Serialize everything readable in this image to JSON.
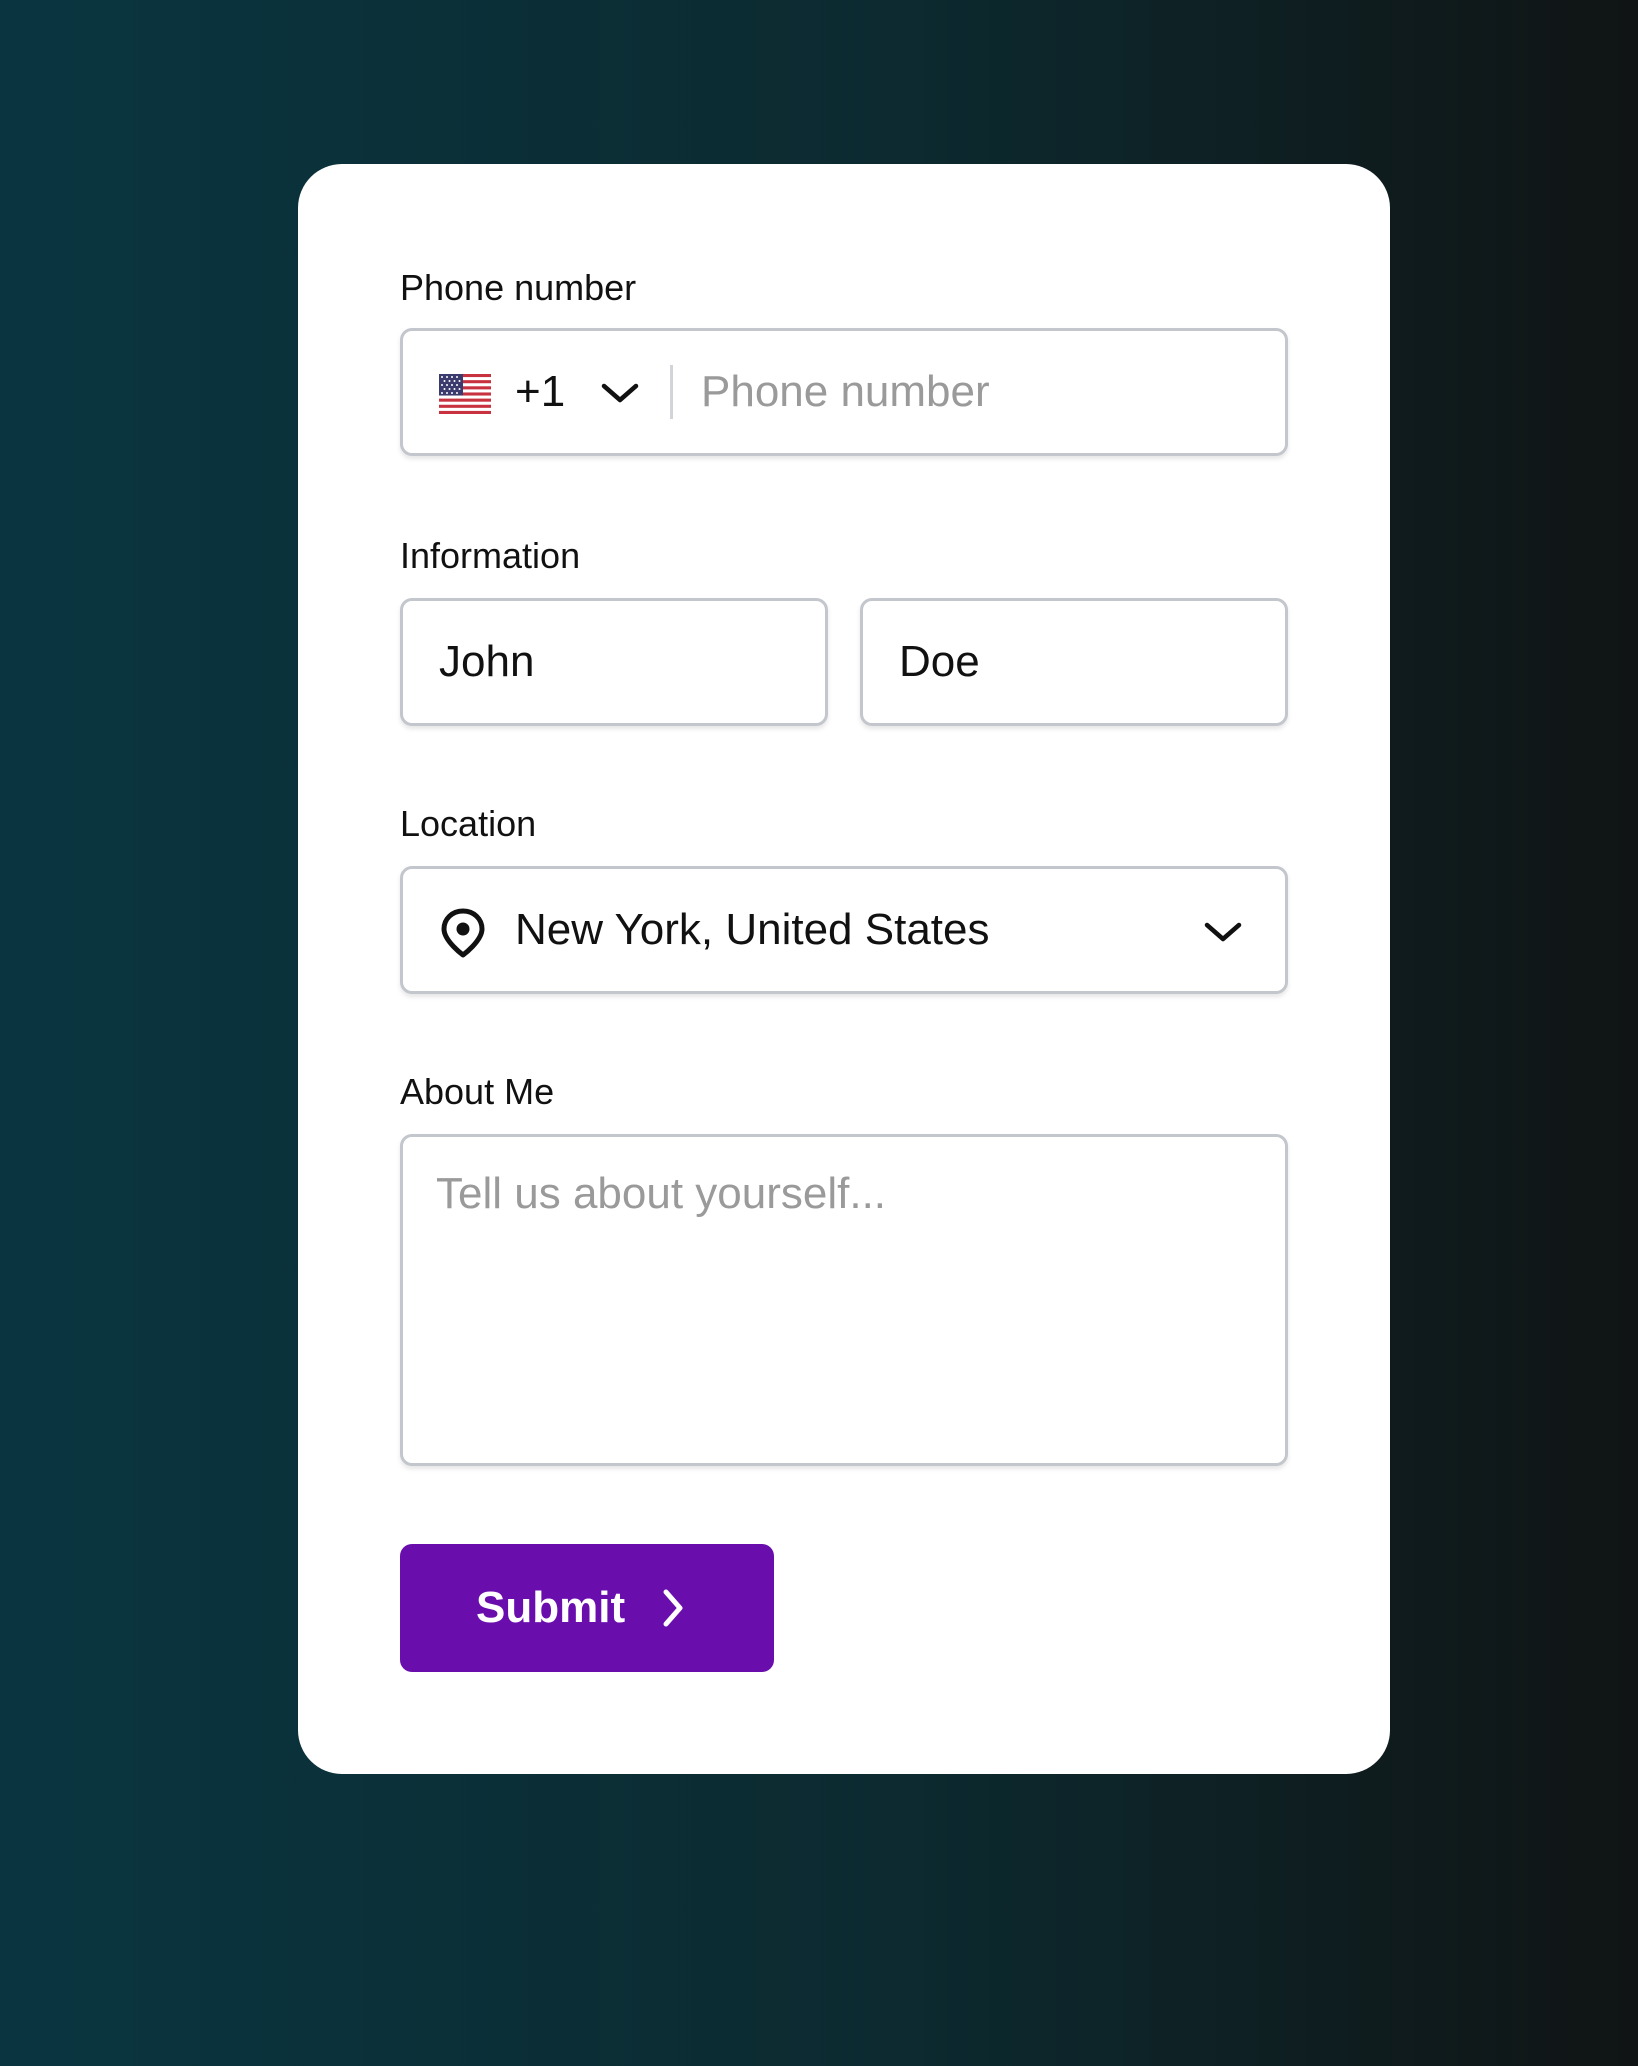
{
  "form": {
    "phone": {
      "label": "Phone number",
      "country_code": "+1",
      "country_flag": "us-flag-icon",
      "placeholder": "Phone number"
    },
    "information": {
      "label": "Information",
      "first_name": "John",
      "last_name": "Doe"
    },
    "location": {
      "label": "Location",
      "value": "New York, United States",
      "icon": "location-pin-icon"
    },
    "about": {
      "label": "About Me",
      "placeholder": "Tell us about yourself..."
    },
    "submit": {
      "label": "Submit",
      "color": "#6a0dad"
    }
  }
}
